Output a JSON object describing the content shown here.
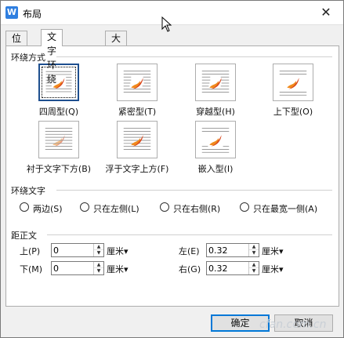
{
  "window": {
    "title": "布局",
    "app_icon_letter": "W",
    "close_glyph": "✕"
  },
  "tabs": [
    {
      "label": "位置"
    },
    {
      "label": "文字环绕"
    },
    {
      "label": "大小"
    }
  ],
  "wrap_style": {
    "section_title": "环绕方式",
    "options": [
      {
        "label": "四周型(Q)",
        "selected": true
      },
      {
        "label": "紧密型(T)",
        "selected": false
      },
      {
        "label": "穿越型(H)",
        "selected": false
      },
      {
        "label": "上下型(O)",
        "selected": false
      },
      {
        "label": "衬于文字下方(B)",
        "selected": false
      },
      {
        "label": "浮于文字上方(F)",
        "selected": false
      },
      {
        "label": "嵌入型(I)",
        "selected": false
      }
    ]
  },
  "wrap_text": {
    "section_title": "环绕文字",
    "options": [
      {
        "label": "两边(S)"
      },
      {
        "label": "只在左侧(L)"
      },
      {
        "label": "只在右侧(R)"
      },
      {
        "label": "只在最宽一侧(A)"
      }
    ]
  },
  "distance": {
    "section_title": "距正文",
    "top": {
      "label": "上(P)",
      "value": "0",
      "unit": "厘米▾"
    },
    "bottom": {
      "label": "下(M)",
      "value": "0",
      "unit": "厘米▾"
    },
    "left": {
      "label": "左(E)",
      "value": "0.32",
      "unit": "厘米▾"
    },
    "right": {
      "label": "右(G)",
      "value": "0.32",
      "unit": "厘米▾"
    }
  },
  "buttons": {
    "ok": "确定",
    "cancel": "取消"
  },
  "watermark": "cfan.com.cn",
  "colors": {
    "accent": "#0078d7",
    "selected_border": "#1e4f8f",
    "flame_orange": "#f08a1c",
    "flame_red": "#d9441a"
  }
}
